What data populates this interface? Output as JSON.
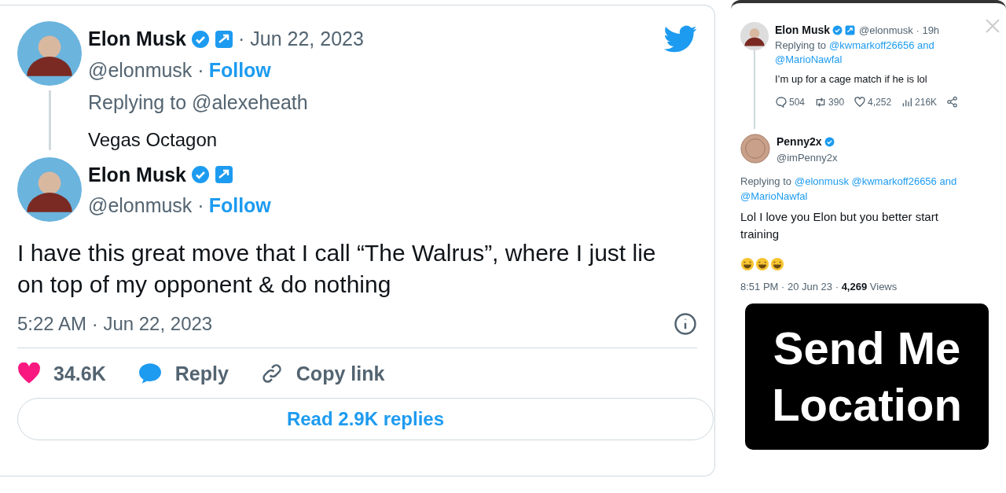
{
  "main_tweet": {
    "parent": {
      "name": "Elon Musk",
      "date": "· Jun 22, 2023",
      "handle": "@elonmusk ·",
      "follow": "Follow",
      "replying": "Replying to @alexeheath",
      "text": "Vegas Octagon"
    },
    "reply": {
      "name": "Elon Musk",
      "handle": "@elonmusk ·",
      "follow": "Follow",
      "text": "I have this great move that I call “The Walrus”, where I just lie on top of my opponent & do nothing",
      "timestamp": "5:22 AM · Jun 22, 2023"
    },
    "actions": [
      {
        "kind": "like",
        "label": "34.6K"
      },
      {
        "kind": "reply",
        "label": "Reply"
      },
      {
        "kind": "link",
        "label": "Copy link"
      }
    ],
    "read_replies": "Read 2.9K replies"
  },
  "story": {
    "tweet": {
      "name": "Elon Musk",
      "handle": "@elonmusk · 19h",
      "replying": "Replying to",
      "mentions": [
        "@kwmarkoff26656 and",
        "@MarioNawfal"
      ],
      "text": "I’m up for a cage match if he is lol",
      "stats": [
        {
          "kind": "reply",
          "label": "504"
        },
        {
          "kind": "retweet",
          "label": "390"
        },
        {
          "kind": "like",
          "label": "4,252"
        },
        {
          "kind": "views",
          "label": "216K"
        }
      ]
    },
    "reply": {
      "name": "Penny2x",
      "handle": "@imPenny2x",
      "replying": "Replying to",
      "mentions": [
        "@elonmusk @kwmarkoff26656 and",
        "@MarioNawfal"
      ],
      "text": "Lol I love you Elon but you better start training",
      "time": "8:51 PM · 20 Jun 23 ·",
      "views": "4,269",
      "views_label": "Views"
    },
    "sticker": [
      "Send Me",
      "Location"
    ]
  }
}
